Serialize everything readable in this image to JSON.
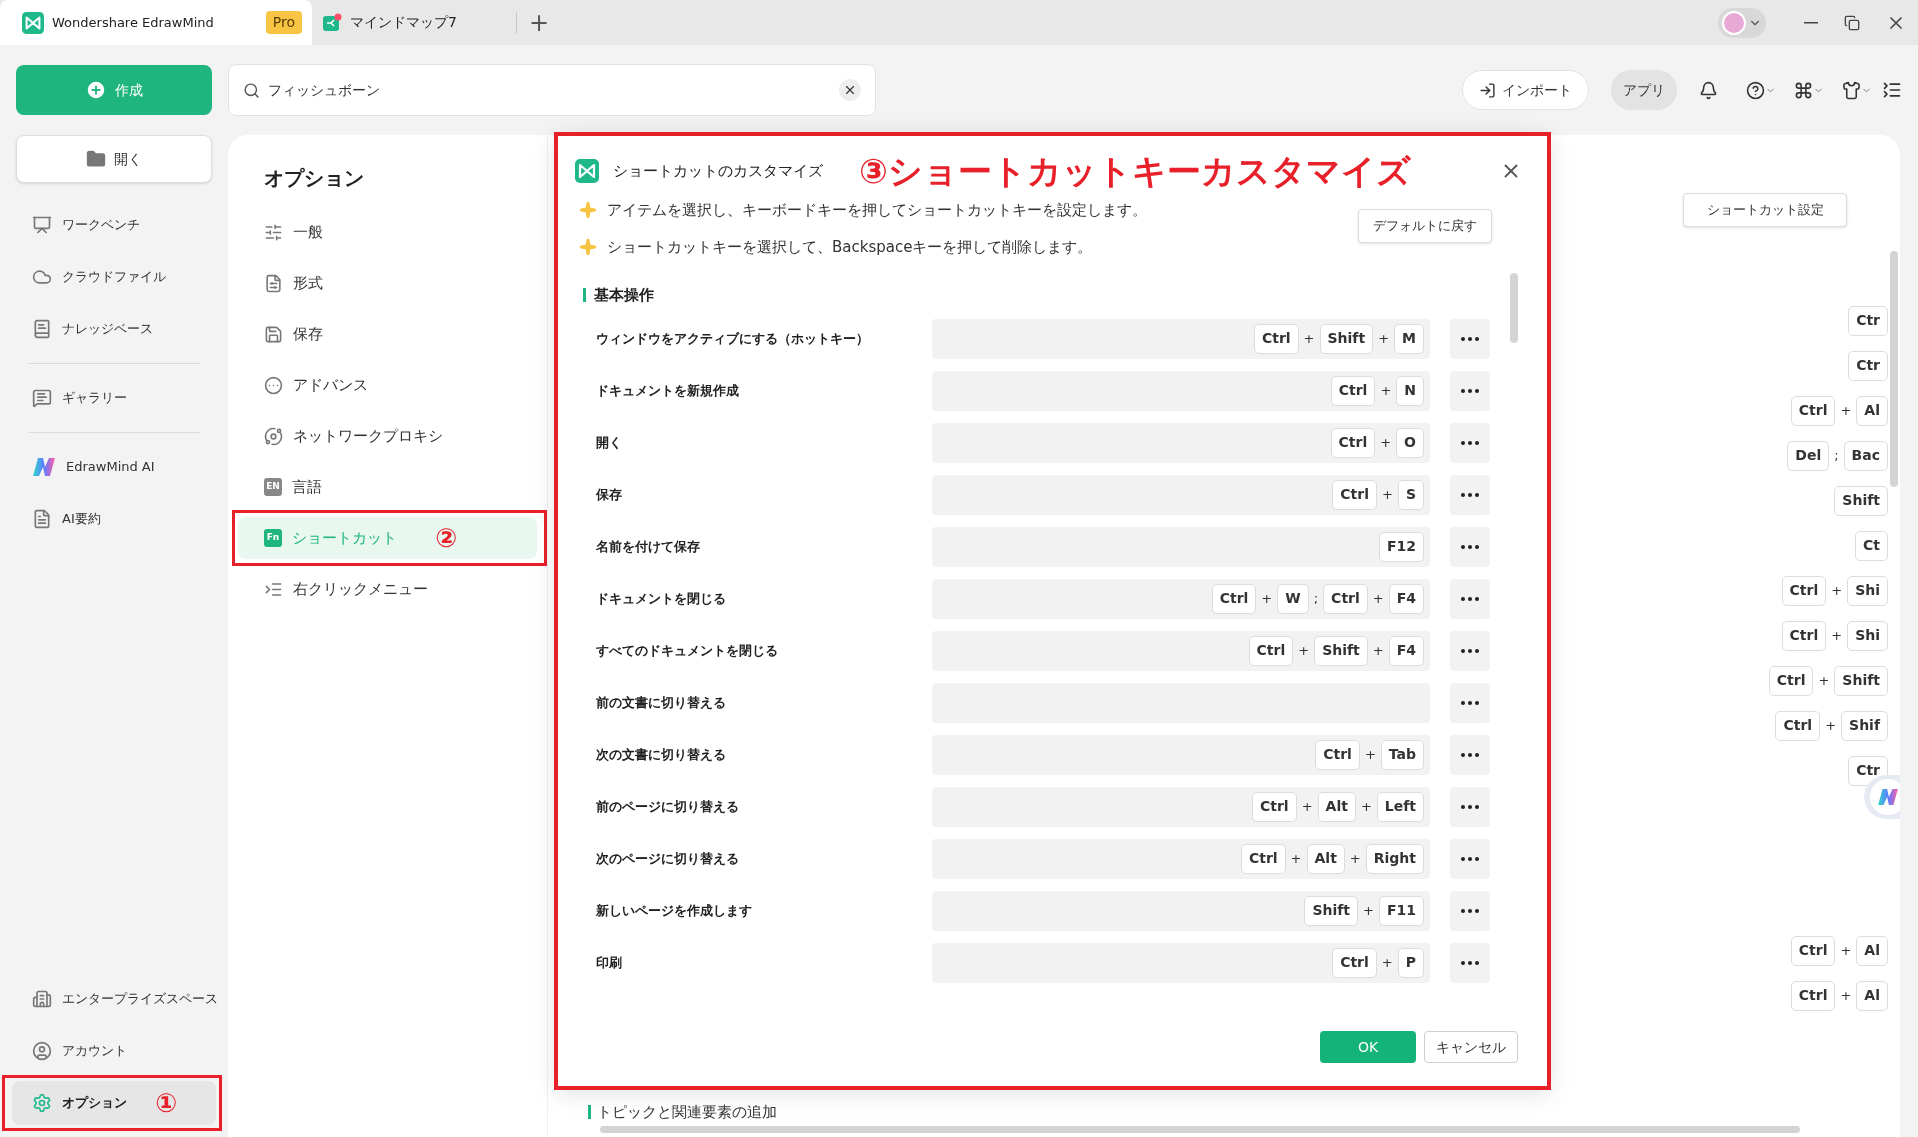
{
  "titlebar": {
    "app_tab": {
      "title": "Wondershare EdrawMind",
      "badge": "Pro",
      "selected": true
    },
    "doc_tab": {
      "title": "マインドマップ7",
      "selected": false
    },
    "new_tab": "+"
  },
  "toolbar": {
    "create": "作成",
    "search": {
      "value": "フィッシュボーン"
    },
    "import": "インポート",
    "apps": "アプリ"
  },
  "sidebar": {
    "open": "開く",
    "groups": [
      [
        {
          "label": "ワークベンチ",
          "selected": false
        },
        {
          "label": "クラウドファイル",
          "selected": false
        },
        {
          "label": "ナレッジベース",
          "selected": false
        }
      ],
      [
        {
          "label": "ギャラリー",
          "selected": false
        }
      ],
      [
        {
          "label": "EdrawMind AI",
          "selected": false
        },
        {
          "label": "AI要約",
          "selected": false
        }
      ]
    ],
    "bottom_items": [
      {
        "label": "エンタープライズスペース",
        "selected": false
      },
      {
        "label": "アカウント",
        "selected": false
      },
      {
        "label": "オプション",
        "selected": true,
        "annotation": "①"
      }
    ]
  },
  "options": {
    "title": "オプション",
    "items": [
      {
        "label": "一般",
        "selected": false
      },
      {
        "label": "形式",
        "selected": false
      },
      {
        "label": "保存",
        "selected": false
      },
      {
        "label": "アドバンス",
        "selected": false
      },
      {
        "label": "ネットワークプロキシ",
        "selected": false
      },
      {
        "label": "言語",
        "icon_text": "EN",
        "selected": false
      },
      {
        "label": "ショートカット",
        "icon_text": "Fn",
        "selected": true,
        "annotation": "②"
      },
      {
        "label": "右クリックメニュー",
        "selected": false
      }
    ]
  },
  "background": {
    "settings_button": "ショートカット設定",
    "rows": [
      [
        {
          "kind": "key",
          "text": "Ctr"
        }
      ],
      [
        {
          "kind": "key",
          "text": "Ctr"
        }
      ],
      [
        {
          "kind": "key",
          "text": "Ctrl"
        },
        {
          "kind": "sep",
          "text": "+"
        },
        {
          "kind": "key",
          "text": "Al"
        }
      ],
      [
        {
          "kind": "key",
          "text": "Del"
        },
        {
          "kind": "sep",
          "text": ";"
        },
        {
          "kind": "key",
          "text": "Bac"
        }
      ],
      [
        {
          "kind": "key",
          "text": "Shift"
        }
      ],
      [
        {
          "kind": "key",
          "text": "Ct"
        }
      ],
      [
        {
          "kind": "key",
          "text": "Ctrl"
        },
        {
          "kind": "sep",
          "text": "+"
        },
        {
          "kind": "key",
          "text": "Shi"
        }
      ],
      [
        {
          "kind": "key",
          "text": "Ctrl"
        },
        {
          "kind": "sep",
          "text": "+"
        },
        {
          "kind": "key",
          "text": "Shi"
        }
      ],
      [
        {
          "kind": "key",
          "text": "Ctrl"
        },
        {
          "kind": "sep",
          "text": "+"
        },
        {
          "kind": "key",
          "text": "Shift"
        }
      ],
      [
        {
          "kind": "key",
          "text": "Ctrl"
        },
        {
          "kind": "sep",
          "text": "+"
        },
        {
          "kind": "key",
          "text": "Shif"
        }
      ],
      [
        {
          "kind": "key",
          "text": "Ctr"
        }
      ],
      [],
      [],
      [],
      [
        {
          "kind": "key",
          "text": "Ctrl"
        },
        {
          "kind": "sep",
          "text": "+"
        },
        {
          "kind": "key",
          "text": "Al"
        }
      ],
      [
        {
          "kind": "key",
          "text": "Ctrl"
        },
        {
          "kind": "sep",
          "text": "+"
        },
        {
          "kind": "key",
          "text": "Al"
        }
      ]
    ],
    "section": "トピックと関連要素の追加"
  },
  "dialog": {
    "title": "ショートカットのカスタマイズ",
    "annotation": "③ショートカットキーカスタマイズ",
    "tips": [
      "アイテムを選択し、キーボードキーを押してショートカットキーを設定します。",
      "ショートカットキーを選択して、Backspaceキーを押して削除します。"
    ],
    "reset": "デフォルトに戻す",
    "section": "基本操作",
    "rows": [
      {
        "label": "ウィンドウをアクティブにする（ホットキー）",
        "keys": [
          {
            "kind": "key",
            "text": "Ctrl"
          },
          {
            "kind": "sep",
            "text": "+"
          },
          {
            "kind": "key",
            "text": "Shift"
          },
          {
            "kind": "sep",
            "text": "+"
          },
          {
            "kind": "key",
            "text": "M"
          }
        ]
      },
      {
        "label": "ドキュメントを新規作成",
        "keys": [
          {
            "kind": "key",
            "text": "Ctrl"
          },
          {
            "kind": "sep",
            "text": "+"
          },
          {
            "kind": "key",
            "text": "N"
          }
        ]
      },
      {
        "label": "開く",
        "keys": [
          {
            "kind": "key",
            "text": "Ctrl"
          },
          {
            "kind": "sep",
            "text": "+"
          },
          {
            "kind": "key",
            "text": "O"
          }
        ]
      },
      {
        "label": "保存",
        "keys": [
          {
            "kind": "key",
            "text": "Ctrl"
          },
          {
            "kind": "sep",
            "text": "+"
          },
          {
            "kind": "key",
            "text": "S"
          }
        ]
      },
      {
        "label": "名前を付けて保存",
        "keys": [
          {
            "kind": "key",
            "text": "F12"
          }
        ]
      },
      {
        "label": "ドキュメントを閉じる",
        "keys": [
          {
            "kind": "key",
            "text": "Ctrl"
          },
          {
            "kind": "sep",
            "text": "+"
          },
          {
            "kind": "key",
            "text": "W"
          },
          {
            "kind": "sep",
            "text": ";"
          },
          {
            "kind": "key",
            "text": "Ctrl"
          },
          {
            "kind": "sep",
            "text": "+"
          },
          {
            "kind": "key",
            "text": "F4"
          }
        ]
      },
      {
        "label": "すべてのドキュメントを閉じる",
        "keys": [
          {
            "kind": "key",
            "text": "Ctrl"
          },
          {
            "kind": "sep",
            "text": "+"
          },
          {
            "kind": "key",
            "text": "Shift"
          },
          {
            "kind": "sep",
            "text": "+"
          },
          {
            "kind": "key",
            "text": "F4"
          }
        ]
      },
      {
        "label": "前の文書に切り替える",
        "keys": []
      },
      {
        "label": "次の文書に切り替える",
        "keys": [
          {
            "kind": "key",
            "text": "Ctrl"
          },
          {
            "kind": "sep",
            "text": "+"
          },
          {
            "kind": "key",
            "text": "Tab"
          }
        ]
      },
      {
        "label": "前のページに切り替える",
        "keys": [
          {
            "kind": "key",
            "text": "Ctrl"
          },
          {
            "kind": "sep",
            "text": "+"
          },
          {
            "kind": "key",
            "text": "Alt"
          },
          {
            "kind": "sep",
            "text": "+"
          },
          {
            "kind": "key",
            "text": "Left"
          }
        ]
      },
      {
        "label": "次のページに切り替える",
        "keys": [
          {
            "kind": "key",
            "text": "Ctrl"
          },
          {
            "kind": "sep",
            "text": "+"
          },
          {
            "kind": "key",
            "text": "Alt"
          },
          {
            "kind": "sep",
            "text": "+"
          },
          {
            "kind": "key",
            "text": "Right"
          }
        ]
      },
      {
        "label": "新しいページを作成します",
        "keys": [
          {
            "kind": "key",
            "text": "Shift"
          },
          {
            "kind": "sep",
            "text": "+"
          },
          {
            "kind": "key",
            "text": "F11"
          }
        ]
      },
      {
        "label": "印刷",
        "keys": [
          {
            "kind": "key",
            "text": "Ctrl"
          },
          {
            "kind": "sep",
            "text": "+"
          },
          {
            "kind": "key",
            "text": "P"
          }
        ]
      }
    ],
    "ok": "OK",
    "cancel": "キャンセル"
  }
}
